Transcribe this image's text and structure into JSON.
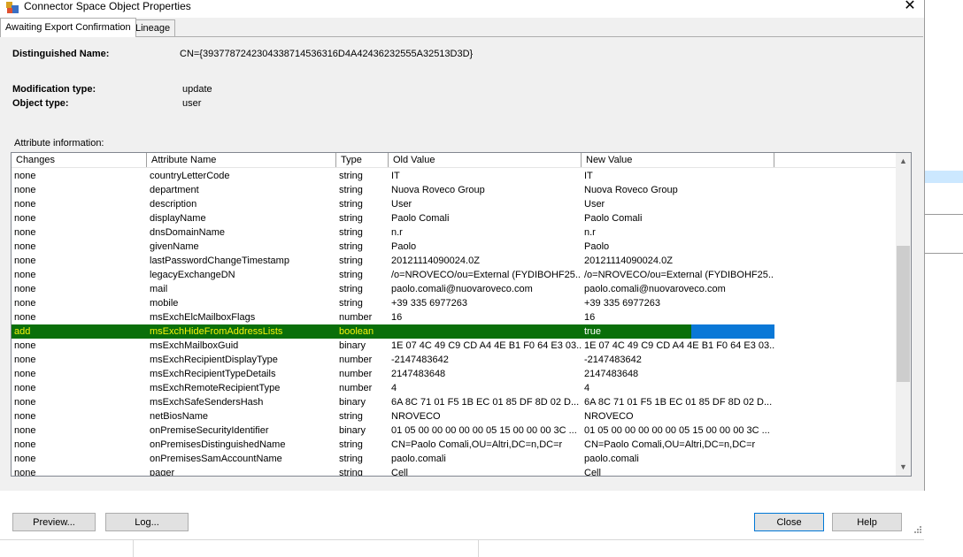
{
  "window": {
    "title": "Connector Space Object Properties",
    "close_glyph": "✕",
    "icon": "app-icon"
  },
  "tabs": [
    {
      "label": "Awaiting Export Confirmation",
      "active": true
    },
    {
      "label": "Lineage",
      "active": false
    }
  ],
  "details": {
    "dn_label": "Distinguished Name:",
    "dn_value": "CN={393778724230433871453631 6D4A42436232555A32513D3D}",
    "mod_label": "Modification type:",
    "mod_value": "update",
    "obj_label": "Object type:",
    "obj_value": "user",
    "attr_info_label": "Attribute information:"
  },
  "table": {
    "columns": [
      "Changes",
      "Attribute Name",
      "Type",
      "Old Value",
      "New Value"
    ],
    "rows": [
      [
        "none",
        "countryLetterCode",
        "string",
        "IT",
        "IT"
      ],
      [
        "none",
        "department",
        "string",
        "Nuova Roveco Group",
        "Nuova Roveco Group"
      ],
      [
        "none",
        "description",
        "string",
        "User",
        "User"
      ],
      [
        "none",
        "displayName",
        "string",
        "Paolo Comali",
        "Paolo Comali"
      ],
      [
        "none",
        "dnsDomainName",
        "string",
        "n.r",
        "n.r"
      ],
      [
        "none",
        "givenName",
        "string",
        "Paolo",
        "Paolo"
      ],
      [
        "none",
        "lastPasswordChangeTimestamp",
        "string",
        "20121114090024.0Z",
        "20121114090024.0Z"
      ],
      [
        "none",
        "legacyExchangeDN",
        "string",
        "/o=NROVECO/ou=External (FYDIBOHF25...",
        "/o=NROVECO/ou=External (FYDIBOHF25..."
      ],
      [
        "none",
        "mail",
        "string",
        "paolo.comali@nuovaroveco.com",
        "paolo.comali@nuovaroveco.com"
      ],
      [
        "none",
        "mobile",
        "string",
        "+39 335 6977263",
        "+39 335 6977263"
      ],
      [
        "none",
        "msExchElcMailboxFlags",
        "number",
        "16",
        "16"
      ],
      [
        "add",
        "msExchHideFromAddressLists",
        "boolean",
        "",
        "true"
      ],
      [
        "none",
        "msExchMailboxGuid",
        "binary",
        "1E 07 4C 49 C9 CD A4 4E B1 F0 64 E3 03...",
        "1E 07 4C 49 C9 CD A4 4E B1 F0 64 E3 03..."
      ],
      [
        "none",
        "msExchRecipientDisplayType",
        "number",
        "-2147483642",
        "-2147483642"
      ],
      [
        "none",
        "msExchRecipientTypeDetails",
        "number",
        "2147483648",
        "2147483648"
      ],
      [
        "none",
        "msExchRemoteRecipientType",
        "number",
        "4",
        "4"
      ],
      [
        "none",
        "msExchSafeSendersHash",
        "binary",
        "6A 8C 71 01 F5 1B EC 01 85 DF 8D 02 D...",
        "6A 8C 71 01 F5 1B EC 01 85 DF 8D 02 D..."
      ],
      [
        "none",
        "netBiosName",
        "string",
        "NROVECO",
        "NROVECO"
      ],
      [
        "none",
        "onPremiseSecurityIdentifier",
        "binary",
        "01 05 00 00 00 00 00 05 15 00 00 00 3C ...",
        "01 05 00 00 00 00 00 05 15 00 00 00 3C ..."
      ],
      [
        "none",
        "onPremisesDistinguishedName",
        "string",
        "CN=Paolo Comali,OU=Altri,DC=n,DC=r",
        "CN=Paolo Comali,OU=Altri,DC=n,DC=r"
      ],
      [
        "none",
        "onPremisesSamAccountName",
        "string",
        "paolo.comali",
        "paolo.comali"
      ],
      [
        "none",
        "pager",
        "string",
        "Cell",
        "Cell"
      ]
    ],
    "selected_index": 11,
    "colors": {
      "selected_bg": "#0a6f0a",
      "selected_text": "#f4f10c",
      "selection_blue": "#0a78d7"
    }
  },
  "buttons": {
    "preview": "Preview...",
    "log": "Log...",
    "close": "Close",
    "help": "Help"
  }
}
